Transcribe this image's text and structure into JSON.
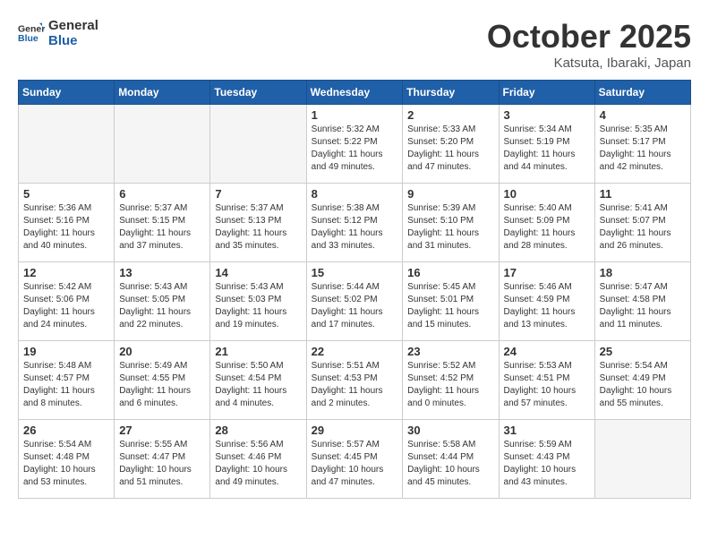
{
  "header": {
    "logo_general": "General",
    "logo_blue": "Blue",
    "month": "October 2025",
    "location": "Katsuta, Ibaraki, Japan"
  },
  "weekdays": [
    "Sunday",
    "Monday",
    "Tuesday",
    "Wednesday",
    "Thursday",
    "Friday",
    "Saturday"
  ],
  "weeks": [
    [
      {
        "day": "",
        "info": ""
      },
      {
        "day": "",
        "info": ""
      },
      {
        "day": "",
        "info": ""
      },
      {
        "day": "1",
        "info": "Sunrise: 5:32 AM\nSunset: 5:22 PM\nDaylight: 11 hours\nand 49 minutes."
      },
      {
        "day": "2",
        "info": "Sunrise: 5:33 AM\nSunset: 5:20 PM\nDaylight: 11 hours\nand 47 minutes."
      },
      {
        "day": "3",
        "info": "Sunrise: 5:34 AM\nSunset: 5:19 PM\nDaylight: 11 hours\nand 44 minutes."
      },
      {
        "day": "4",
        "info": "Sunrise: 5:35 AM\nSunset: 5:17 PM\nDaylight: 11 hours\nand 42 minutes."
      }
    ],
    [
      {
        "day": "5",
        "info": "Sunrise: 5:36 AM\nSunset: 5:16 PM\nDaylight: 11 hours\nand 40 minutes."
      },
      {
        "day": "6",
        "info": "Sunrise: 5:37 AM\nSunset: 5:15 PM\nDaylight: 11 hours\nand 37 minutes."
      },
      {
        "day": "7",
        "info": "Sunrise: 5:37 AM\nSunset: 5:13 PM\nDaylight: 11 hours\nand 35 minutes."
      },
      {
        "day": "8",
        "info": "Sunrise: 5:38 AM\nSunset: 5:12 PM\nDaylight: 11 hours\nand 33 minutes."
      },
      {
        "day": "9",
        "info": "Sunrise: 5:39 AM\nSunset: 5:10 PM\nDaylight: 11 hours\nand 31 minutes."
      },
      {
        "day": "10",
        "info": "Sunrise: 5:40 AM\nSunset: 5:09 PM\nDaylight: 11 hours\nand 28 minutes."
      },
      {
        "day": "11",
        "info": "Sunrise: 5:41 AM\nSunset: 5:07 PM\nDaylight: 11 hours\nand 26 minutes."
      }
    ],
    [
      {
        "day": "12",
        "info": "Sunrise: 5:42 AM\nSunset: 5:06 PM\nDaylight: 11 hours\nand 24 minutes."
      },
      {
        "day": "13",
        "info": "Sunrise: 5:43 AM\nSunset: 5:05 PM\nDaylight: 11 hours\nand 22 minutes."
      },
      {
        "day": "14",
        "info": "Sunrise: 5:43 AM\nSunset: 5:03 PM\nDaylight: 11 hours\nand 19 minutes."
      },
      {
        "day": "15",
        "info": "Sunrise: 5:44 AM\nSunset: 5:02 PM\nDaylight: 11 hours\nand 17 minutes."
      },
      {
        "day": "16",
        "info": "Sunrise: 5:45 AM\nSunset: 5:01 PM\nDaylight: 11 hours\nand 15 minutes."
      },
      {
        "day": "17",
        "info": "Sunrise: 5:46 AM\nSunset: 4:59 PM\nDaylight: 11 hours\nand 13 minutes."
      },
      {
        "day": "18",
        "info": "Sunrise: 5:47 AM\nSunset: 4:58 PM\nDaylight: 11 hours\nand 11 minutes."
      }
    ],
    [
      {
        "day": "19",
        "info": "Sunrise: 5:48 AM\nSunset: 4:57 PM\nDaylight: 11 hours\nand 8 minutes."
      },
      {
        "day": "20",
        "info": "Sunrise: 5:49 AM\nSunset: 4:55 PM\nDaylight: 11 hours\nand 6 minutes."
      },
      {
        "day": "21",
        "info": "Sunrise: 5:50 AM\nSunset: 4:54 PM\nDaylight: 11 hours\nand 4 minutes."
      },
      {
        "day": "22",
        "info": "Sunrise: 5:51 AM\nSunset: 4:53 PM\nDaylight: 11 hours\nand 2 minutes."
      },
      {
        "day": "23",
        "info": "Sunrise: 5:52 AM\nSunset: 4:52 PM\nDaylight: 11 hours\nand 0 minutes."
      },
      {
        "day": "24",
        "info": "Sunrise: 5:53 AM\nSunset: 4:51 PM\nDaylight: 10 hours\nand 57 minutes."
      },
      {
        "day": "25",
        "info": "Sunrise: 5:54 AM\nSunset: 4:49 PM\nDaylight: 10 hours\nand 55 minutes."
      }
    ],
    [
      {
        "day": "26",
        "info": "Sunrise: 5:54 AM\nSunset: 4:48 PM\nDaylight: 10 hours\nand 53 minutes."
      },
      {
        "day": "27",
        "info": "Sunrise: 5:55 AM\nSunset: 4:47 PM\nDaylight: 10 hours\nand 51 minutes."
      },
      {
        "day": "28",
        "info": "Sunrise: 5:56 AM\nSunset: 4:46 PM\nDaylight: 10 hours\nand 49 minutes."
      },
      {
        "day": "29",
        "info": "Sunrise: 5:57 AM\nSunset: 4:45 PM\nDaylight: 10 hours\nand 47 minutes."
      },
      {
        "day": "30",
        "info": "Sunrise: 5:58 AM\nSunset: 4:44 PM\nDaylight: 10 hours\nand 45 minutes."
      },
      {
        "day": "31",
        "info": "Sunrise: 5:59 AM\nSunset: 4:43 PM\nDaylight: 10 hours\nand 43 minutes."
      },
      {
        "day": "",
        "info": ""
      }
    ]
  ]
}
